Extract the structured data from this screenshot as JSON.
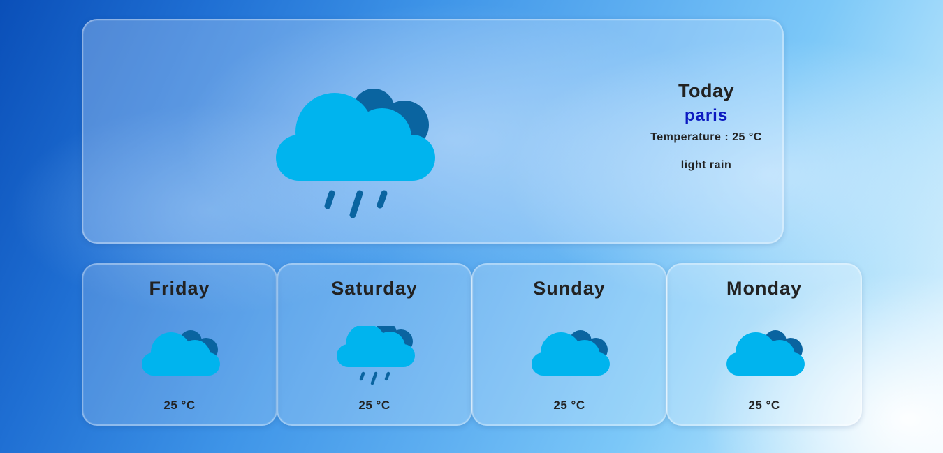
{
  "today": {
    "title": "Today",
    "city": "paris",
    "temperature": "Temperature : 25 °C",
    "description": "light rain",
    "icon": "rain-cloud-icon"
  },
  "forecast": [
    {
      "day": "Friday",
      "temp": "25 °C",
      "icon": "cloud-icon"
    },
    {
      "day": "Saturday",
      "temp": "25 °C",
      "icon": "rain-cloud-icon"
    },
    {
      "day": "Sunday",
      "temp": "25 °C",
      "icon": "cloud-icon"
    },
    {
      "day": "Monday",
      "temp": "25 °C",
      "icon": "cloud-icon"
    }
  ],
  "colors": {
    "cloud_front": "#00b4ee",
    "cloud_back": "#0a64a0",
    "rain": "#0a64a0",
    "city_text": "#0b19c0"
  }
}
